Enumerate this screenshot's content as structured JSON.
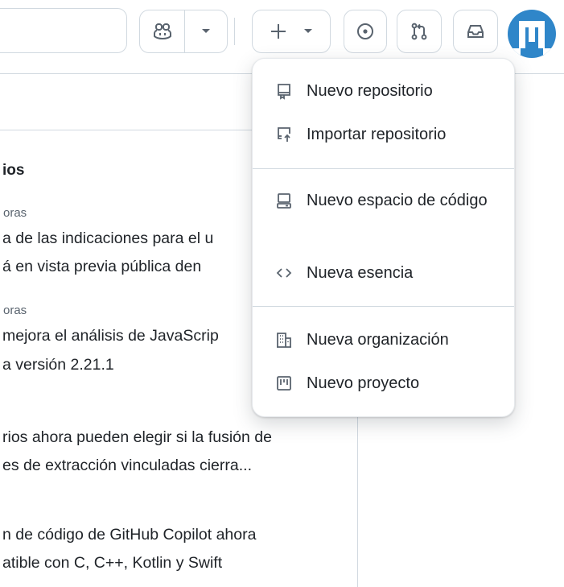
{
  "menu": {
    "items": [
      {
        "label": "Nuevo repositorio",
        "icon": "repo-icon"
      },
      {
        "label": "Importar repositorio",
        "icon": "repo-push-icon"
      },
      {
        "label": "Nuevo espacio de código",
        "icon": "codespaces-icon"
      },
      {
        "label": "Nueva esencia",
        "icon": "code-icon"
      },
      {
        "label": "Nueva organización",
        "icon": "organization-icon"
      },
      {
        "label": "Nuevo proyecto",
        "icon": "project-icon"
      }
    ]
  },
  "feed": {
    "section_title": "ios",
    "items": [
      {
        "meta": "oras",
        "line1": "a de las indicaciones para el u",
        "line2": "á en vista previa pública den"
      },
      {
        "meta": "oras",
        "line1": "mejora el análisis de JavaScrip",
        "line2": "a versión 2.21.1"
      },
      {
        "meta": "",
        "line1": "rios ahora pueden elegir si la fusión de",
        "line2": "es de extracción vinculadas cierra..."
      },
      {
        "meta": "",
        "line1": "n de código de GitHub Copilot ahora",
        "line2": "atible con C, C++, Kotlin y Swift"
      }
    ]
  },
  "colors": {
    "border": "#d1d9e0",
    "icon": "#59636e",
    "text": "#1f2328",
    "avatar": "#2f86c9"
  }
}
